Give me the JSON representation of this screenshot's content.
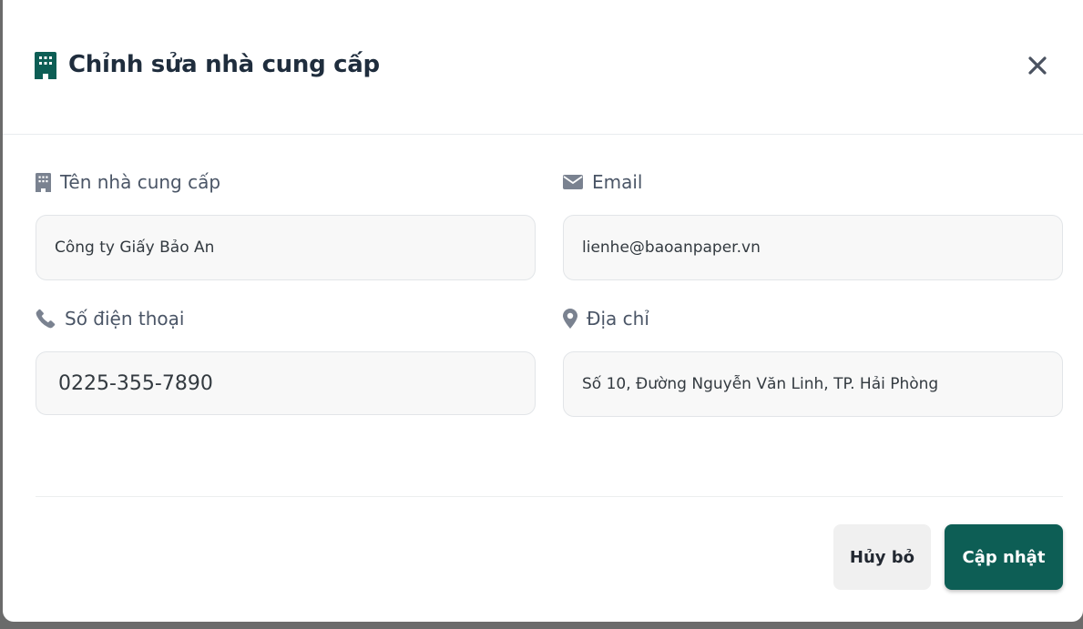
{
  "modal": {
    "title": "Chỉnh sửa nhà cung cấp",
    "accent_color": "#0d5e55",
    "title_icon": "building-icon",
    "close_icon": "close-icon"
  },
  "form": {
    "name": {
      "label": "Tên nhà cung cấp",
      "icon": "building-icon",
      "value": "Công ty Giấy Bảo An"
    },
    "email": {
      "label": "Email",
      "icon": "envelope-icon",
      "value": "lienhe@baoanpaper.vn"
    },
    "phone": {
      "label": "Số điện thoại",
      "icon": "phone-icon",
      "value": "0225-355-7890"
    },
    "address": {
      "label": "Địa chỉ",
      "icon": "map-pin-icon",
      "value": "Số 10, Đường Nguyễn Văn Linh, TP. Hải Phòng"
    }
  },
  "footer": {
    "cancel_label": "Hủy bỏ",
    "submit_label": "Cập nhật"
  }
}
